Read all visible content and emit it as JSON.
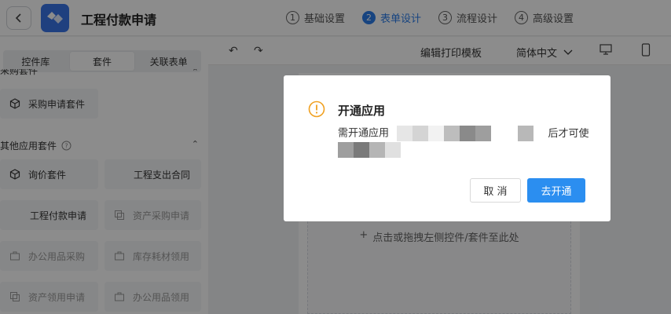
{
  "header": {
    "title": "工程付款申请",
    "steps": [
      {
        "num": "1",
        "label": "基础设置"
      },
      {
        "num": "2",
        "label": "表单设计"
      },
      {
        "num": "3",
        "label": "流程设计"
      },
      {
        "num": "4",
        "label": "高级设置"
      }
    ],
    "active_step": 1,
    "accent": "#2b7de9"
  },
  "left_panel": {
    "tabs": [
      "控件库",
      "套件",
      "关联表单"
    ],
    "active_tab": 1,
    "section1": "采购套件",
    "kit_purchase": "采购申请套件",
    "section2": "其他应用套件",
    "kits": [
      "询价套件",
      "工程支出合同",
      "工程付款申请",
      "资产采购申请",
      "办公用品采购",
      "库存耗材领用",
      "资产领用申请",
      "办公用品领用"
    ]
  },
  "toolbar": {
    "print_template": "编辑打印模板",
    "language": "简体中文"
  },
  "canvas": {
    "drop_hint": "点击或拖拽左侧控件/套件至此处"
  },
  "modal": {
    "title": "开通应用",
    "text_prefix": "需开通应用",
    "text_suffix": "后才可使",
    "cancel_label": "取 消",
    "ok_label": "去开通",
    "warn_color": "#f0a020",
    "ok_color": "#2b8ef0"
  }
}
